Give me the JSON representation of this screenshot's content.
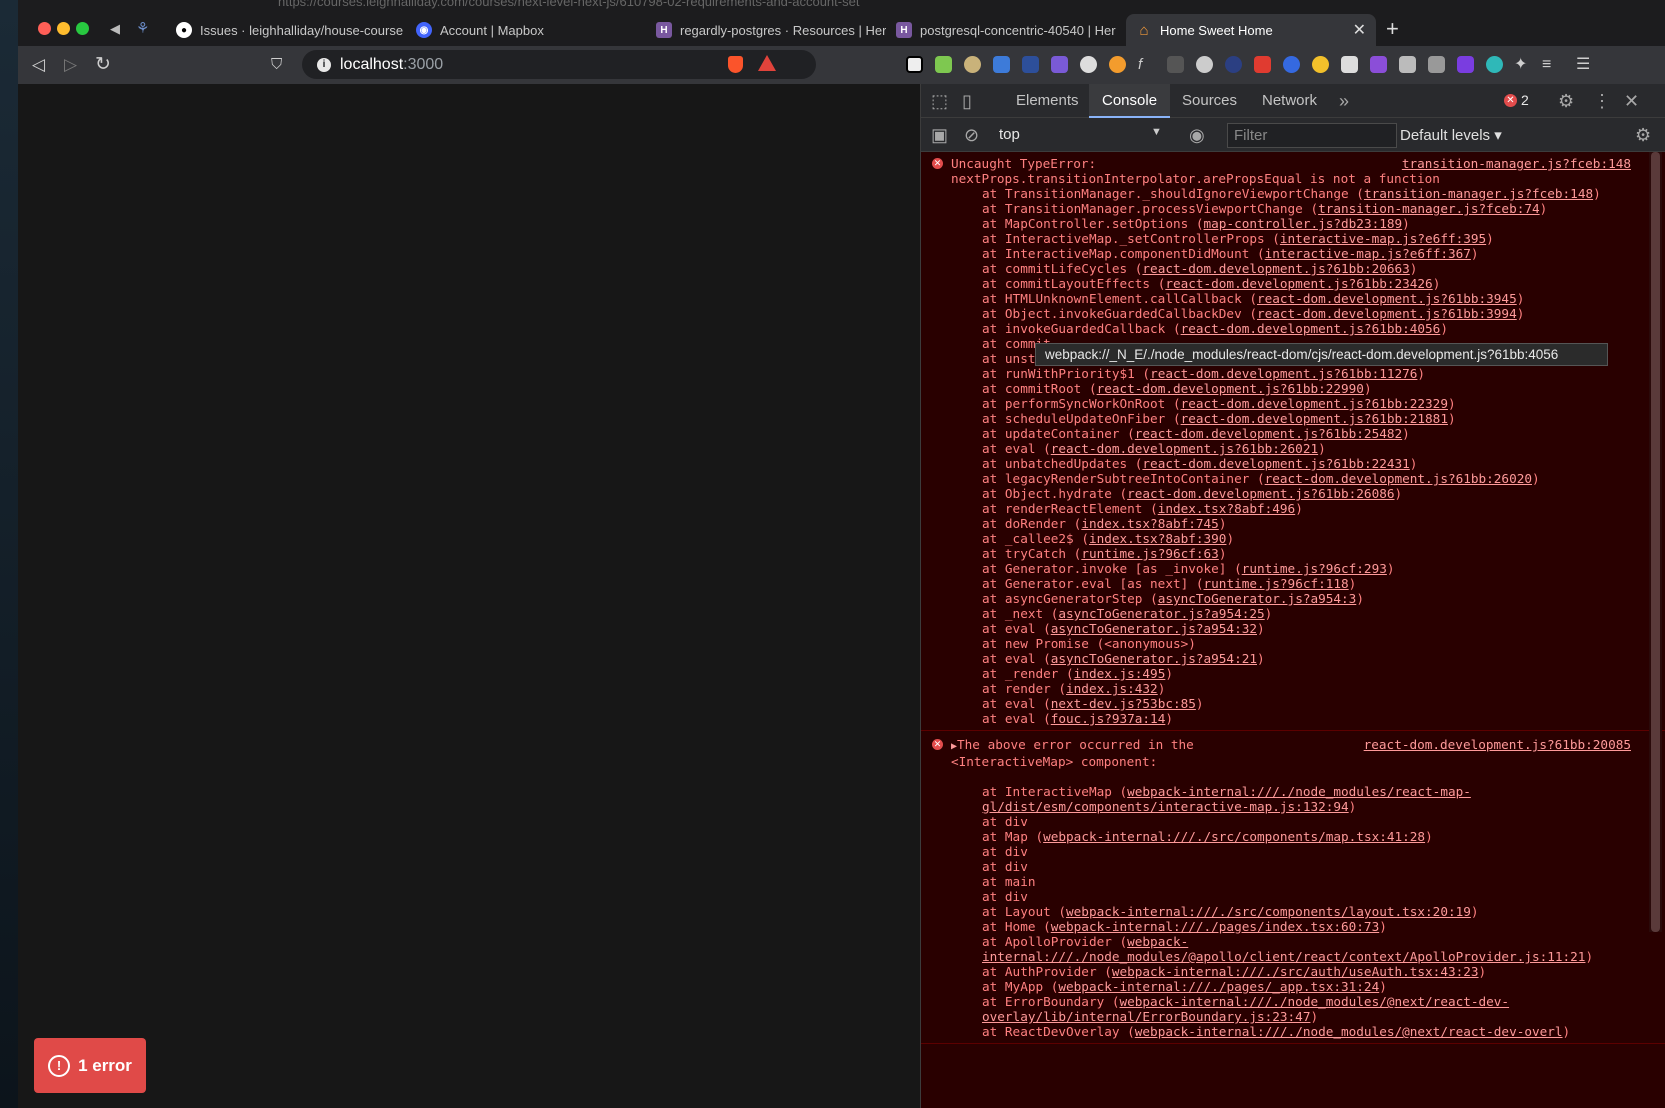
{
  "browser": {
    "tabs": [
      {
        "label": "Issues · leighhalliday/house-course",
        "icon": "github-icon"
      },
      {
        "label": "Account | Mapbox",
        "icon": "mapbox-icon"
      },
      {
        "label": "regardly-postgres · Resources | Her",
        "icon": "heroku-icon"
      },
      {
        "label": "postgresql-concentric-40540 | Her",
        "icon": "heroku-icon"
      },
      {
        "label": "Home Sweet Home",
        "icon": "home-icon",
        "active": true
      }
    ],
    "background_url": "https://courses.leighhalliday.com/courses/next-level-next-js/610798-02-requirements-and-account-set",
    "url_host": "localhost",
    "url_port": ":3000"
  },
  "page": {
    "error_badge": "1 error",
    "error_badge_icon": "!"
  },
  "devtools": {
    "tabs": [
      "Elements",
      "Console",
      "Sources",
      "Network"
    ],
    "active_tab": "Console",
    "error_count": "2",
    "context": "top",
    "filter_placeholder": "Filter",
    "levels": "Default levels"
  },
  "console": {
    "error1": {
      "source": "transition-manager.js?fceb:148",
      "message": "Uncaught TypeError:\nnextProps.transitionInterpolator.arePropsEqual is not a function",
      "frames": [
        [
          "TransitionManager._shouldIgnoreViewportChange ",
          "transition-manager.js?fceb:148"
        ],
        [
          "TransitionManager.processViewportChange ",
          "transition-manager.js?fceb:74"
        ],
        [
          "MapController.setOptions ",
          "map-controller.js?db23:189"
        ],
        [
          "InteractiveMap._setControllerProps ",
          "interactive-map.js?e6ff:395"
        ],
        [
          "InteractiveMap.componentDidMount ",
          "interactive-map.js?e6ff:367"
        ],
        [
          "commitLifeCycles ",
          "react-dom.development.js?61bb:20663"
        ],
        [
          "commitLayoutEffects ",
          "react-dom.development.js?61bb:23426"
        ],
        [
          "HTMLUnknownElement.callCallback ",
          "react-dom.development.js?61bb:3945"
        ],
        [
          "Object.invokeGuardedCallbackDev ",
          "react-dom.development.js?61bb:3994"
        ],
        [
          "invokeGuardedCallback ",
          "react-dom.development.js?61bb:4056"
        ],
        [
          "commit",
          ""
        ],
        [
          "unstab",
          ""
        ],
        [
          "runWithPriority$1 ",
          "react-dom.development.js?61bb:11276"
        ],
        [
          "commitRoot ",
          "react-dom.development.js?61bb:22990"
        ],
        [
          "performSyncWorkOnRoot ",
          "react-dom.development.js?61bb:22329"
        ],
        [
          "scheduleUpdateOnFiber ",
          "react-dom.development.js?61bb:21881"
        ],
        [
          "updateContainer ",
          "react-dom.development.js?61bb:25482"
        ],
        [
          "eval ",
          "react-dom.development.js?61bb:26021"
        ],
        [
          "unbatchedUpdates ",
          "react-dom.development.js?61bb:22431"
        ],
        [
          "legacyRenderSubtreeIntoContainer ",
          "react-dom.development.js?61bb:26020"
        ],
        [
          "Object.hydrate ",
          "react-dom.development.js?61bb:26086"
        ],
        [
          "renderReactElement ",
          "index.tsx?8abf:496"
        ],
        [
          "doRender ",
          "index.tsx?8abf:745"
        ],
        [
          "_callee2$ ",
          "index.tsx?8abf:390"
        ],
        [
          "tryCatch ",
          "runtime.js?96cf:63"
        ],
        [
          "Generator.invoke [as _invoke] ",
          "runtime.js?96cf:293"
        ],
        [
          "Generator.eval [as next] ",
          "runtime.js?96cf:118"
        ],
        [
          "asyncGeneratorStep ",
          "asyncToGenerator.js?a954:3"
        ],
        [
          "_next ",
          "asyncToGenerator.js?a954:25"
        ],
        [
          "eval ",
          "asyncToGenerator.js?a954:32"
        ],
        [
          "new Promise (<anonymous>)",
          ""
        ],
        [
          "eval ",
          "asyncToGenerator.js?a954:21"
        ],
        [
          "_render ",
          "index.js:495"
        ],
        [
          "render ",
          "index.js:432"
        ],
        [
          "eval ",
          "next-dev.js?53bc:85"
        ],
        [
          "eval ",
          "fouc.js?937a:14"
        ]
      ]
    },
    "error2": {
      "source": "react-dom.development.js?61bb:20085",
      "message": "The above error occurred in the\n<InteractiveMap> component:",
      "frames": [
        [
          "InteractiveMap ",
          "webpack-internal:///./node_modules/react-map-gl/dist/esm/components/interactive-map.js:132:94"
        ],
        [
          "div",
          ""
        ],
        [
          "Map ",
          "webpack-internal:///./src/components/map.tsx:41:28"
        ],
        [
          "div",
          ""
        ],
        [
          "div",
          ""
        ],
        [
          "main",
          ""
        ],
        [
          "div",
          ""
        ],
        [
          "Layout ",
          "webpack-internal:///./src/components/layout.tsx:20:19"
        ],
        [
          "Home ",
          "webpack-internal:///./pages/index.tsx:60:73"
        ],
        [
          "ApolloProvider ",
          "webpack-internal:///./node_modules/@apollo/client/react/context/ApolloProvider.js:11:21"
        ],
        [
          "AuthProvider ",
          "webpack-internal:///./src/auth/useAuth.tsx:43:23"
        ],
        [
          "MyApp ",
          "webpack-internal:///./pages/_app.tsx:31:24"
        ],
        [
          "ErrorBoundary ",
          "webpack-internal:///./node_modules/@next/react-dev-overlay/lib/internal/ErrorBoundary.js:23:47"
        ],
        [
          "ReactDevOverlay ",
          "webpack-internal:///./node_modules/@next/react-dev-overl"
        ]
      ]
    },
    "tooltip": "webpack://_N_E/./node_modules/react-dom/cjs/react-dom.development.js?61bb:4056"
  },
  "colors": {
    "console_bg": "#290000",
    "console_text": "#ff8080",
    "error_red": "#e24c4c",
    "badge_red": "#e04a48",
    "active_tab_underline": "#8ab4f8"
  }
}
